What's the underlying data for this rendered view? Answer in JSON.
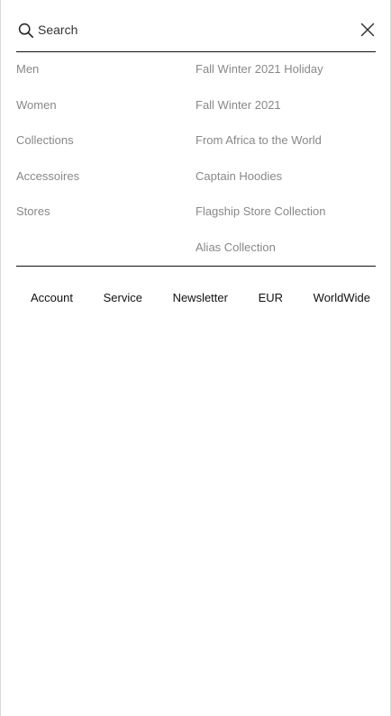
{
  "search": {
    "placeholder": "Search",
    "value": ""
  },
  "menu": {
    "left": [
      {
        "label": "Men"
      },
      {
        "label": "Women"
      },
      {
        "label": "Collections"
      },
      {
        "label": "Accessoires"
      },
      {
        "label": "Stores"
      }
    ],
    "right": [
      {
        "label": "Fall Winter 2021 Holiday"
      },
      {
        "label": "Fall Winter 2021"
      },
      {
        "label": "From Africa to the World"
      },
      {
        "label": "Captain Hoodies"
      },
      {
        "label": "Flagship Store Collection"
      },
      {
        "label": "Alias Collection"
      }
    ]
  },
  "footer": {
    "links": [
      {
        "label": "Account"
      },
      {
        "label": "Service"
      },
      {
        "label": "Newsletter"
      },
      {
        "label": "EUR"
      },
      {
        "label": "WorldWide"
      }
    ]
  },
  "colors": {
    "text": "#111111",
    "muted": "#888888",
    "divider": "#111111",
    "background": "#ffffff"
  },
  "icons": {
    "search": "search-icon",
    "close": "close-icon"
  }
}
